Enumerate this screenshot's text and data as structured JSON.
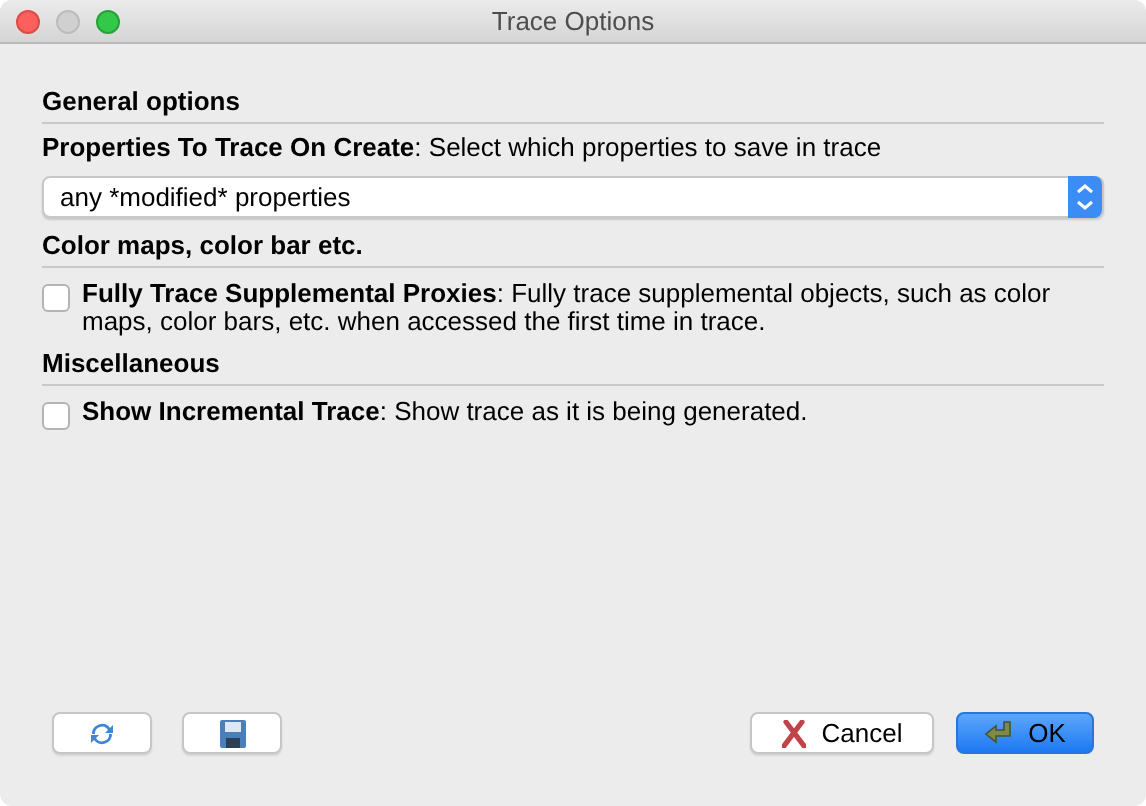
{
  "window": {
    "title": "Trace Options"
  },
  "sections": [
    {
      "heading": "General options",
      "items": [
        {
          "kind": "combo",
          "label": "**Properties To Trace On Create**: Select which properties to save in trace",
          "value": "any *modified* properties"
        }
      ]
    },
    {
      "heading": "Color maps, color bar etc.",
      "items": [
        {
          "kind": "checkbox",
          "label": "**Fully Trace Supplemental Proxies**: Fully trace supplemental objects, such as color maps, color bars, etc. when accessed the first time in trace.",
          "checked": false
        }
      ]
    },
    {
      "heading": "Miscellaneous",
      "items": [
        {
          "kind": "checkbox",
          "label": "**Show Incremental Trace**: Show trace as it is being generated.",
          "checked": false
        }
      ]
    }
  ],
  "buttons": {
    "cancel": "Cancel",
    "ok": "OK"
  }
}
